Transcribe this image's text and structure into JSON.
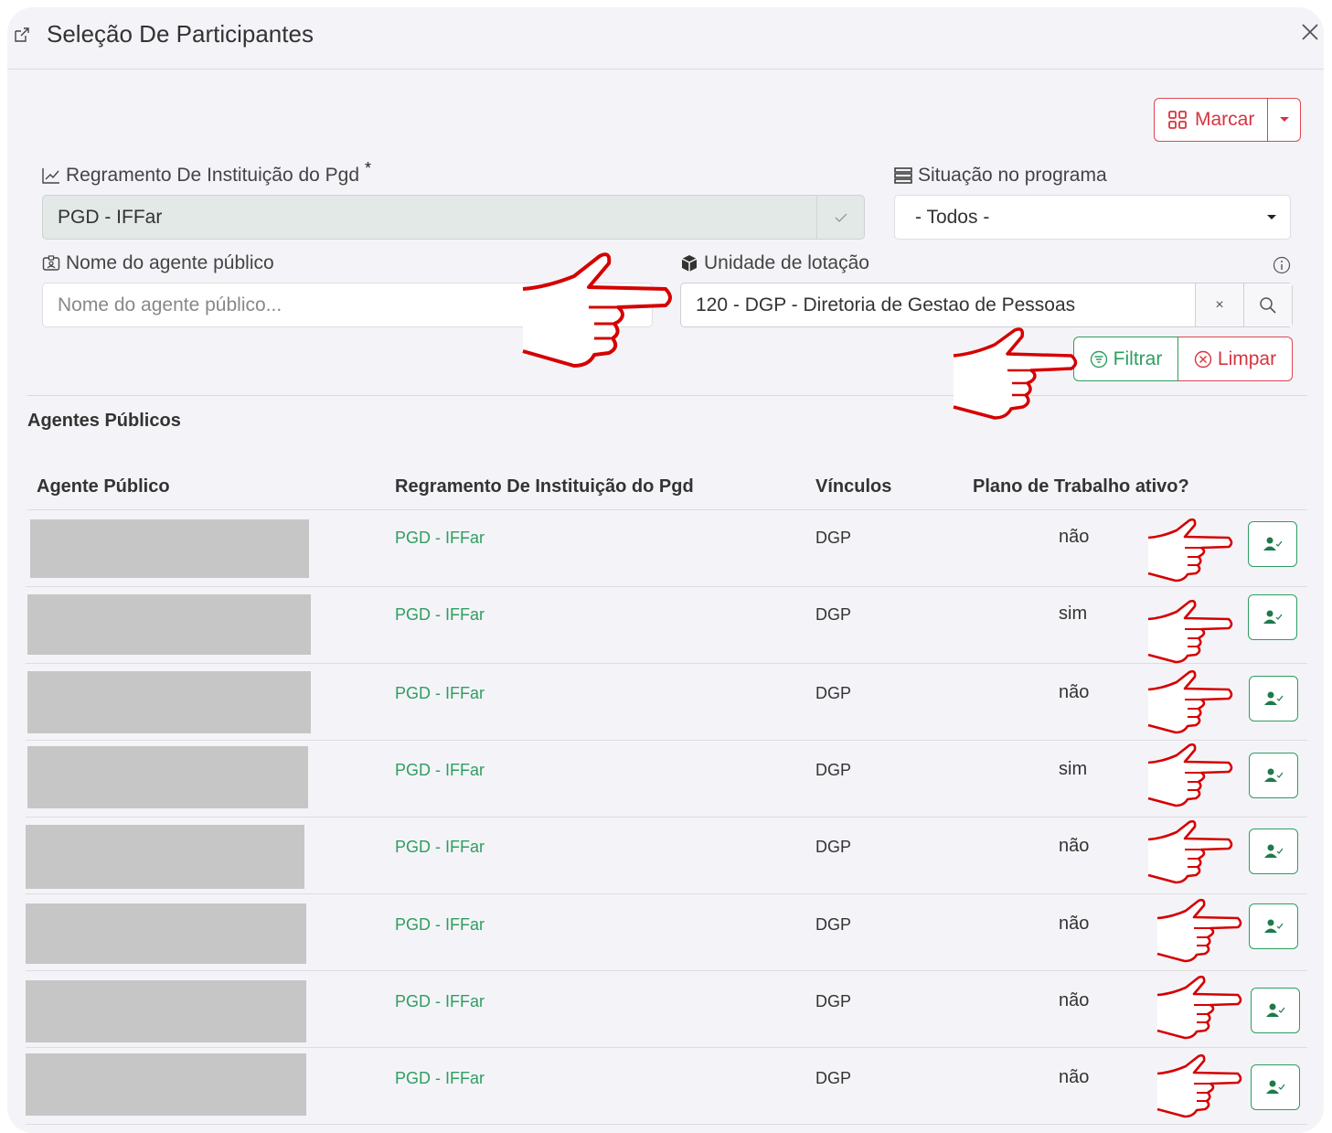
{
  "modal": {
    "title": "Seleção De Participantes"
  },
  "toolbar": {
    "marcar_label": "Marcar"
  },
  "filters": {
    "regramento": {
      "label": "Regramento De Instituição do Pgd",
      "required_mark": "*",
      "value": "PGD - IFFar"
    },
    "situacao": {
      "label": "Situação no programa",
      "value": "- Todos -"
    },
    "nome": {
      "label": "Nome do agente público",
      "placeholder": "Nome do agente público..."
    },
    "unidade": {
      "label": "Unidade de lotação",
      "value": "120 - DGP - Diretoria de Gestao de Pessoas",
      "clear_symbol": "×"
    },
    "filtrar_label": "Filtrar",
    "limpar_label": "Limpar"
  },
  "table": {
    "section_title": "Agentes Públicos",
    "headers": {
      "agente": "Agente Público",
      "regramento": "Regramento De Instituição do Pgd",
      "vinculos": "Vínculos",
      "plano": "Plano de Trabalho ativo?"
    },
    "rows": [
      {
        "regramento": "PGD - IFFar",
        "vinculos": "DGP",
        "plano": "não"
      },
      {
        "regramento": "PGD - IFFar",
        "vinculos": "DGP",
        "plano": "sim"
      },
      {
        "regramento": "PGD - IFFar",
        "vinculos": "DGP",
        "plano": "não"
      },
      {
        "regramento": "PGD - IFFar",
        "vinculos": "DGP",
        "plano": "sim"
      },
      {
        "regramento": "PGD - IFFar",
        "vinculos": "DGP",
        "plano": "não"
      },
      {
        "regramento": "PGD - IFFar",
        "vinculos": "DGP",
        "plano": "não"
      },
      {
        "regramento": "PGD - IFFar",
        "vinculos": "DGP",
        "plano": "não"
      },
      {
        "regramento": "PGD - IFFar",
        "vinculos": "DGP",
        "plano": "não"
      }
    ]
  },
  "colors": {
    "accent_green": "#2e9e60",
    "accent_red": "#d7343f",
    "annotation_red": "#e00000"
  },
  "icons": [
    "external-link-icon",
    "close-icon",
    "grid-icon",
    "caret-down-icon",
    "chart-line-icon",
    "check-icon",
    "list-icon",
    "id-card-icon",
    "cube-icon",
    "info-icon",
    "search-icon",
    "filter-icon",
    "circle-x-icon",
    "user-check-icon",
    "pointing-hand-annotation"
  ]
}
